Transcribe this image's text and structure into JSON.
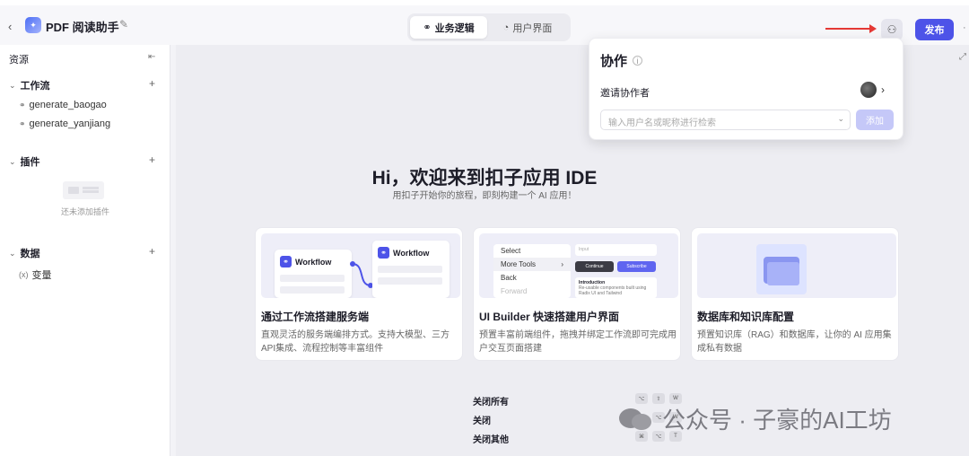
{
  "header": {
    "app_title": "PDF 阅读助手",
    "tabs": [
      {
        "label": "业务逻辑",
        "icon": "workflow-icon",
        "active": true
      },
      {
        "label": "用户界面",
        "icon": "palette-icon",
        "active": false
      }
    ],
    "publish_label": "发布",
    "accent_color": "#4d53e8"
  },
  "sidebar": {
    "title": "资源",
    "sections": [
      {
        "label": "工作流",
        "items": [
          "generate_baogao",
          "generate_yanjiang"
        ]
      },
      {
        "label": "插件",
        "empty_text": "还未添加插件"
      },
      {
        "label": "数据",
        "items": [
          "变量"
        ],
        "item_icon_text": "(x)"
      }
    ]
  },
  "welcome": {
    "title": "Hi，欢迎来到扣子应用 IDE",
    "subtitle": "用扣子开始你的旅程，即刻构建一个 AI 应用！"
  },
  "cards": [
    {
      "title": "通过工作流搭建服务端",
      "desc": "直观灵活的服务端编排方式。支持大模型、三方API集成、流程控制等丰富组件",
      "illu": {
        "node1": "Workflow",
        "node2": "Workflow"
      }
    },
    {
      "title": "UI Builder 快速搭建用户界面",
      "desc": "预置丰富前端组件，拖拽并绑定工作流即可完成用户交互页面搭建",
      "illu": {
        "menu": [
          "Select",
          "More Tools",
          "Back",
          "Forward"
        ],
        "input": "Input",
        "btn_continue": "Continue",
        "btn_subscribe": "Subscribe",
        "intro_title": "Introduction",
        "intro_text": "Re-usable components built using Radix UI and Tailwind"
      }
    },
    {
      "title": "数据库和知识库配置",
      "desc": "预置知识库（RAG）和数据库，让你的 AI 应用集成私有数据"
    }
  ],
  "context_menu": {
    "items": [
      "关闭所有",
      "关闭",
      "关闭其他"
    ],
    "shortcuts": [
      [
        "⌥",
        "⇧",
        "W"
      ],
      [
        "⌥",
        "W"
      ],
      [
        "⌘",
        "⌥",
        "T"
      ]
    ]
  },
  "collab_popover": {
    "title": "协作",
    "invite_label": "邀请协作者",
    "search_placeholder": "输入用户名或昵称进行检索",
    "add_label": "添加"
  },
  "watermark": {
    "text": "公众号 · 子豪的AI工坊"
  }
}
